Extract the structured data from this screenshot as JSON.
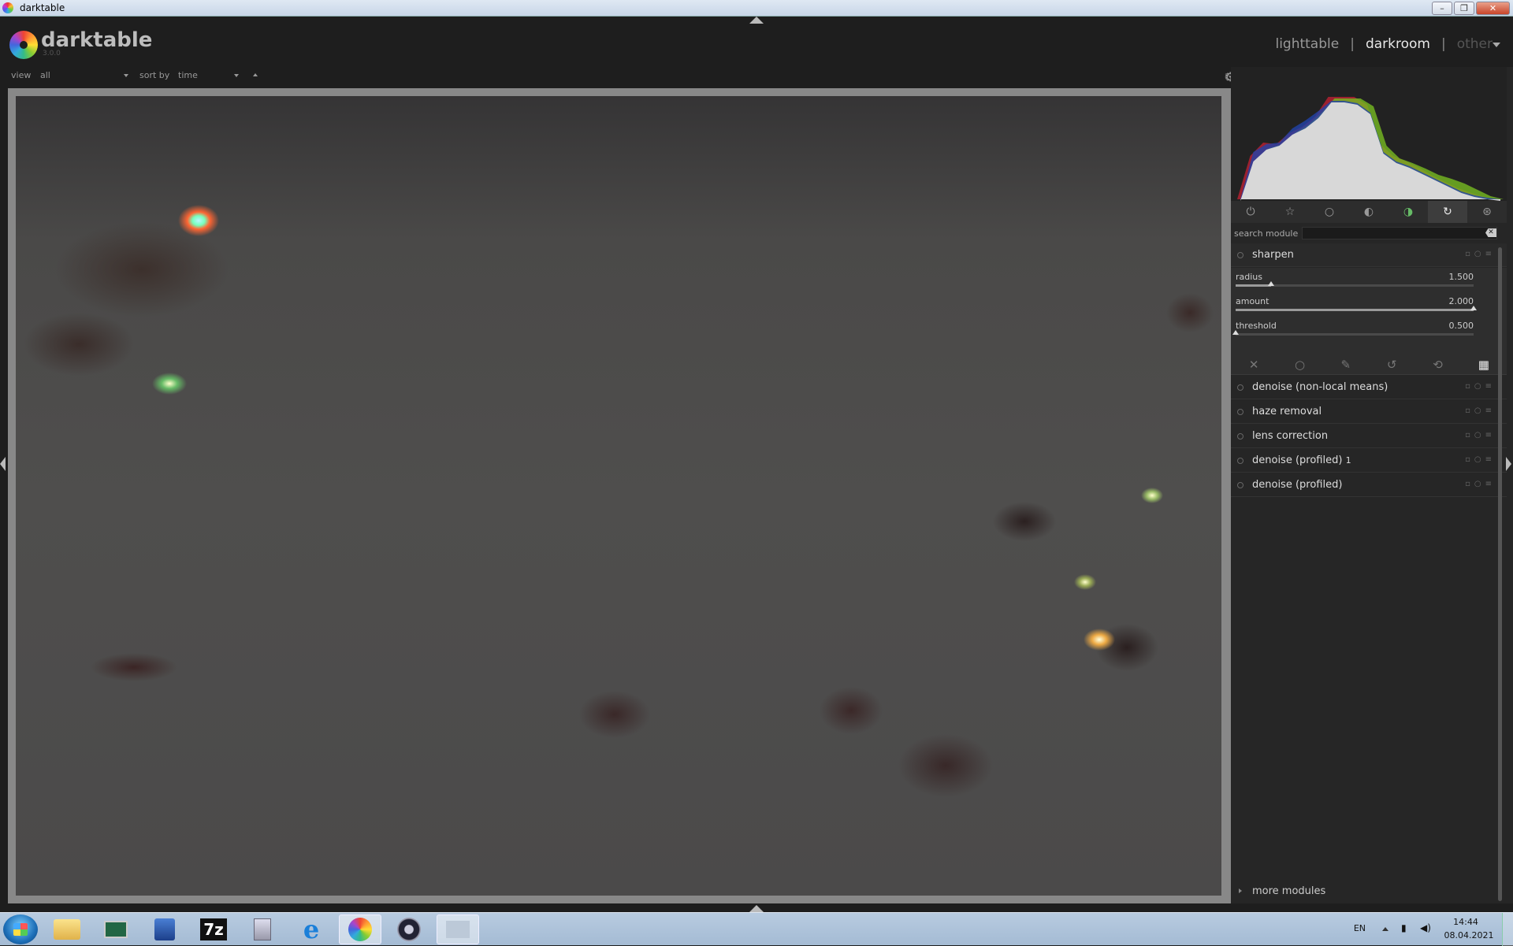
{
  "window": {
    "title": "darktable",
    "buttons": [
      "minimize",
      "restore",
      "close"
    ]
  },
  "header": {
    "logo_name": "darktable",
    "version": "3.0.0",
    "views": [
      {
        "label": "lighttable",
        "state": "inactive"
      },
      {
        "label": "darkroom",
        "state": "active"
      },
      {
        "label": "other",
        "state": "disabled"
      }
    ],
    "separator": "|"
  },
  "filter": {
    "view_label": "view",
    "view_value": "all",
    "sort_label": "sort by",
    "sort_value": "time",
    "right_icons": [
      "G",
      "☆",
      "?"
    ]
  },
  "module_groups": [
    "power-icon",
    "favorite-star-icon",
    "circle-icon",
    "tone-icon",
    "color-icon",
    "correct-icon",
    "effect-icon"
  ],
  "module_groups_active": "correct-icon",
  "search": {
    "label": "search module",
    "value": "",
    "placeholder": ""
  },
  "sharpen": {
    "name": "sharpen",
    "params": [
      {
        "label": "radius",
        "value": "1.500",
        "fraction": 0.15
      },
      {
        "label": "amount",
        "value": "2.000",
        "fraction": 1.0
      },
      {
        "label": "threshold",
        "value": "0.500",
        "fraction": 0.0
      }
    ]
  },
  "blend_modes": [
    "off",
    "uniformly",
    "drawn mask",
    "parametric mask",
    "drawn & parametric mask",
    "raster mask"
  ],
  "blend_active": "raster mask",
  "modules": [
    {
      "name": "denoise (non-local means)",
      "instance": ""
    },
    {
      "name": "haze removal",
      "instance": ""
    },
    {
      "name": "lens correction",
      "instance": ""
    },
    {
      "name": "denoise (profiled)",
      "instance": "1"
    },
    {
      "name": "denoise (profiled)",
      "instance": ""
    }
  ],
  "more_modules": "more modules",
  "histogram": {
    "red": [
      0,
      55,
      72,
      70,
      84,
      92,
      105,
      130,
      130,
      130,
      120,
      70,
      55,
      48,
      40,
      30,
      22,
      14,
      8,
      3,
      0
    ],
    "green": [
      0,
      50,
      65,
      70,
      85,
      95,
      110,
      128,
      128,
      128,
      118,
      68,
      52,
      46,
      39,
      31,
      26,
      20,
      12,
      4,
      0
    ],
    "blue": [
      0,
      60,
      70,
      72,
      90,
      100,
      112,
      125,
      125,
      122,
      110,
      60,
      48,
      42,
      34,
      26,
      18,
      10,
      5,
      2,
      0
    ]
  },
  "taskbar": {
    "apps": [
      {
        "name": "explorer",
        "label": ""
      },
      {
        "name": "remote-desktop",
        "label": ""
      },
      {
        "name": "computer",
        "label": ""
      },
      {
        "name": "7zip",
        "label": "7z"
      },
      {
        "name": "calculator",
        "label": ""
      },
      {
        "name": "internet-explorer",
        "label": "e"
      },
      {
        "name": "darktable",
        "label": ""
      },
      {
        "name": "app-circle",
        "label": ""
      },
      {
        "name": "app-blank",
        "label": ""
      }
    ],
    "active_app": "darktable",
    "lang": "EN",
    "time": "14:44",
    "date": "08.04.2021"
  },
  "colors": {
    "panel_bg": "#262626",
    "accent": "#eeeeee",
    "close_button": "#c8452a"
  }
}
